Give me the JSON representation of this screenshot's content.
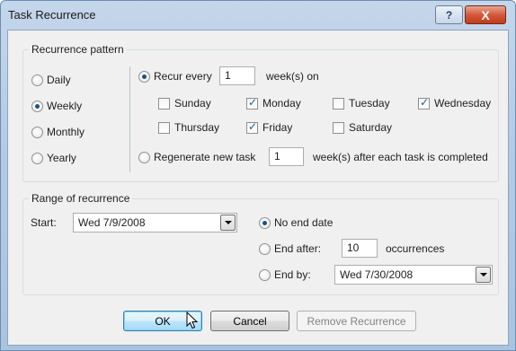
{
  "window": {
    "title": "Task Recurrence",
    "help_label": "?",
    "close_label": "X"
  },
  "recurrence_pattern": {
    "label": "Recurrence pattern",
    "frequency_options": [
      {
        "label": "Daily",
        "selected": false
      },
      {
        "label": "Weekly",
        "selected": true
      },
      {
        "label": "Monthly",
        "selected": false
      },
      {
        "label": "Yearly",
        "selected": false
      }
    ],
    "recur_every": {
      "label": "Recur every",
      "value": "1",
      "suffix": "week(s) on",
      "selected": true
    },
    "days": [
      {
        "label": "Sunday",
        "checked": false
      },
      {
        "label": "Monday",
        "checked": true
      },
      {
        "label": "Tuesday",
        "checked": false
      },
      {
        "label": "Wednesday",
        "checked": true
      },
      {
        "label": "Thursday",
        "checked": false
      },
      {
        "label": "Friday",
        "checked": true
      },
      {
        "label": "Saturday",
        "checked": false
      }
    ],
    "regenerate": {
      "label": "Regenerate new task",
      "value": "1",
      "suffix": "week(s) after each task is completed",
      "selected": false
    }
  },
  "range": {
    "label": "Range of recurrence",
    "start_label": "Start:",
    "start_value": "Wed 7/9/2008",
    "no_end_date": {
      "label": "No end date",
      "selected": true
    },
    "end_after": {
      "label": "End after:",
      "value": "10",
      "suffix": "occurrences",
      "selected": false
    },
    "end_by": {
      "label": "End by:",
      "value": "Wed 7/30/2008",
      "selected": false
    }
  },
  "buttons": {
    "ok": "OK",
    "cancel": "Cancel",
    "remove": "Remove Recurrence"
  }
}
